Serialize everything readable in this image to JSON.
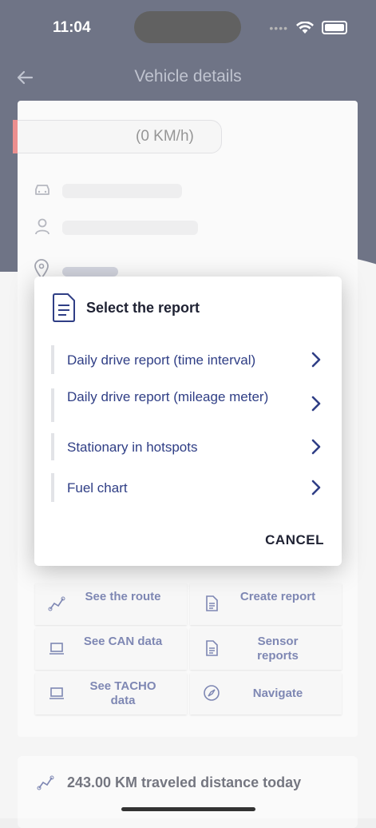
{
  "status_bar": {
    "time": "11:04"
  },
  "header": {
    "title": "Vehicle details"
  },
  "vehicle": {
    "speed": "(0 KM/h)"
  },
  "dialog": {
    "title": "Select the report",
    "options": [
      {
        "label": "Daily drive report (time interval)"
      },
      {
        "label": "Daily drive report (mileage meter)"
      },
      {
        "label": "Stationary in hotspots"
      },
      {
        "label": "Fuel chart"
      }
    ],
    "cancel_label": "CANCEL"
  },
  "actions": {
    "see_route": "See the route",
    "create_report": "Create report",
    "see_can": "See CAN data",
    "sensor_reports": "Sensor reports",
    "see_tacho": "See TACHO data",
    "navigate": "Navigate"
  },
  "summary": {
    "distance_today": "243.00 KM traveled distance today"
  },
  "colors": {
    "accent": "#2f3e85",
    "header": "#18203c",
    "status_red": "#e04b4b"
  }
}
